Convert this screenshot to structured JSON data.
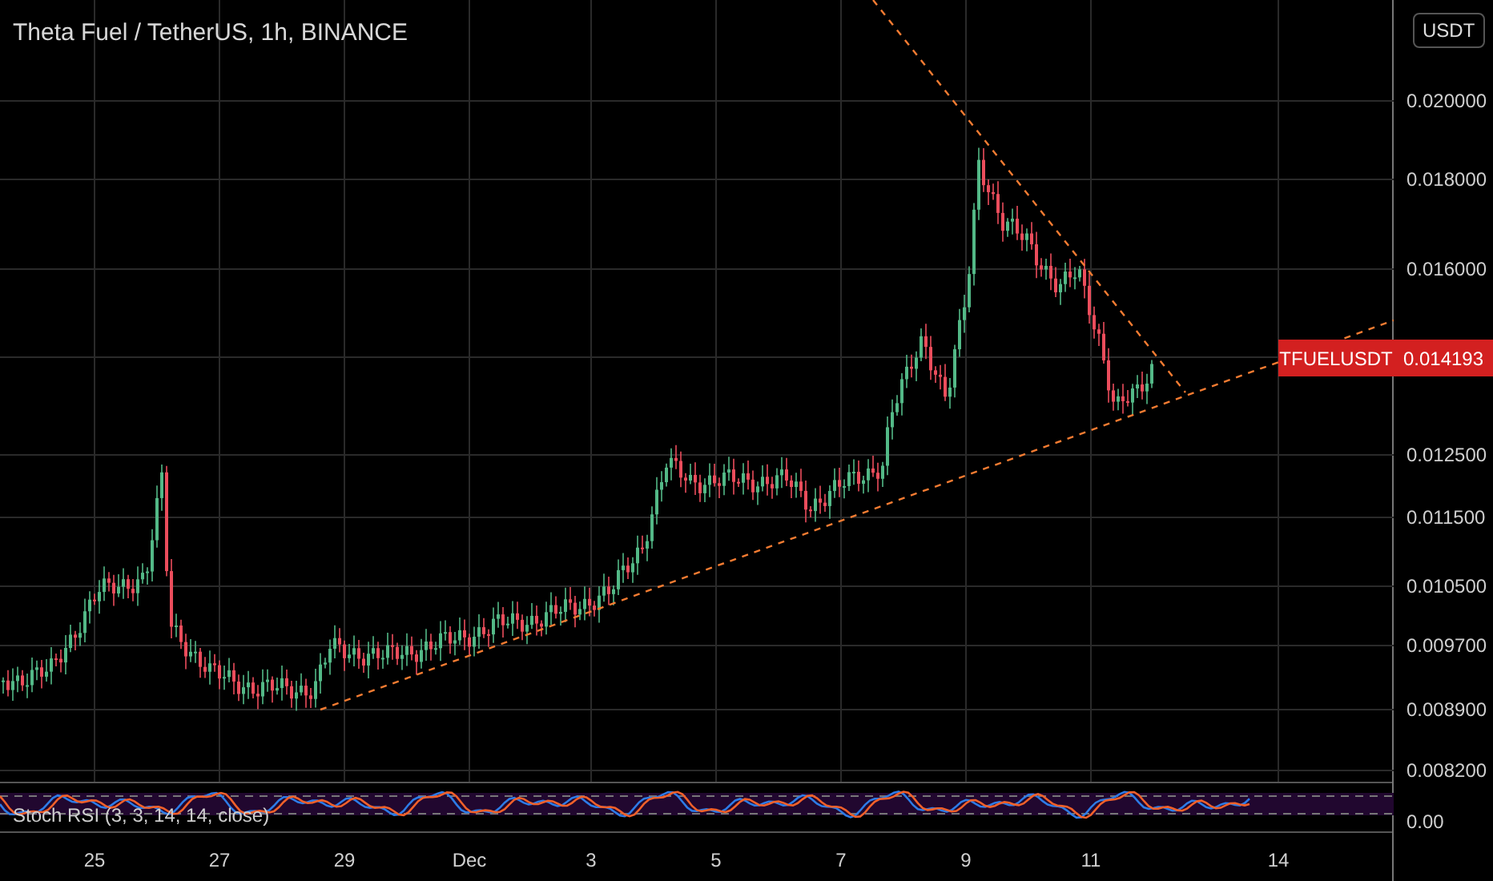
{
  "title": "Theta Fuel / TetherUS, 1h, BINANCE",
  "currency_button": "USDT",
  "price_axis": [
    "0.020000",
    "0.018000",
    "0.016000",
    "0.012500",
    "0.011500",
    "0.010500",
    "0.009700",
    "0.008900",
    "0.008200"
  ],
  "price_label": {
    "symbol": "TFUELUSDT",
    "value": "0.014193"
  },
  "indicator": {
    "label": "Stoch RSI (3, 3, 14, 14, close)",
    "axis_label": "0.00"
  },
  "time_axis": [
    "25",
    "27",
    "29",
    "Dec",
    "3",
    "5",
    "7",
    "9",
    "11",
    "14"
  ]
}
